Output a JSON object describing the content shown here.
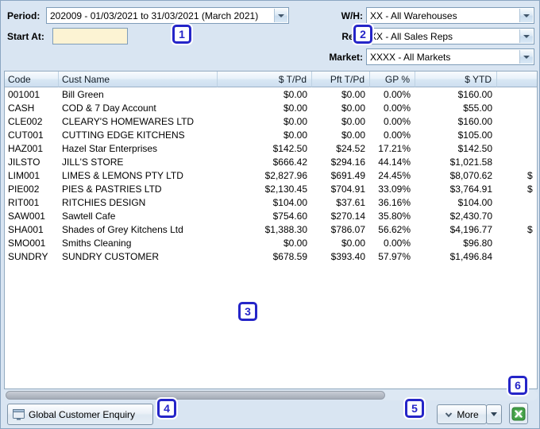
{
  "filters": {
    "period": {
      "label": "Period:",
      "value": "202009 - 01/03/2021 to 31/03/2021 (March 2021)"
    },
    "start_at": {
      "label": "Start At:",
      "value": ""
    },
    "warehouse": {
      "label": "W/H:",
      "value": "XX - All Warehouses"
    },
    "rep": {
      "label": "Rep:",
      "value": "XX - All Sales Reps"
    },
    "market": {
      "label": "Market:",
      "value": "XXXX - All Markets"
    }
  },
  "table": {
    "columns": [
      "Code",
      "Cust Name",
      "$ T/Pd",
      "Pft T/Pd",
      "GP %",
      "$ YTD",
      ""
    ],
    "rows": [
      [
        "001001",
        "Bill Green",
        "$0.00",
        "$0.00",
        "0.00%",
        "$160.00",
        ""
      ],
      [
        "CASH",
        "COD & 7 Day Account",
        "$0.00",
        "$0.00",
        "0.00%",
        "$55.00",
        ""
      ],
      [
        "CLE002",
        "CLEARY'S HOMEWARES LTD",
        "$0.00",
        "$0.00",
        "0.00%",
        "$160.00",
        ""
      ],
      [
        "CUT001",
        "CUTTING EDGE KITCHENS",
        "$0.00",
        "$0.00",
        "0.00%",
        "$105.00",
        ""
      ],
      [
        "HAZ001",
        "Hazel Star Enterprises",
        "$142.50",
        "$24.52",
        "17.21%",
        "$142.50",
        ""
      ],
      [
        "JILSTO",
        "JILL'S STORE",
        "$666.42",
        "$294.16",
        "44.14%",
        "$1,021.58",
        ""
      ],
      [
        "LIM001",
        "LIMES & LEMONS PTY LTD",
        "$2,827.96",
        "$691.49",
        "24.45%",
        "$8,070.62",
        "$"
      ],
      [
        "PIE002",
        "PIES & PASTRIES LTD",
        "$2,130.45",
        "$704.91",
        "33.09%",
        "$3,764.91",
        "$"
      ],
      [
        "RIT001",
        "RITCHIES DESIGN",
        "$104.00",
        "$37.61",
        "36.16%",
        "$104.00",
        ""
      ],
      [
        "SAW001",
        "Sawtell Cafe",
        "$754.60",
        "$270.14",
        "35.80%",
        "$2,430.70",
        ""
      ],
      [
        "SHA001",
        "Shades of Grey Kitchens Ltd",
        "$1,388.30",
        "$786.07",
        "56.62%",
        "$4,196.77",
        "$"
      ],
      [
        "SMO001",
        "Smiths Cleaning",
        "$0.00",
        "$0.00",
        "0.00%",
        "$96.80",
        ""
      ],
      [
        "SUNDRY",
        "SUNDRY CUSTOMER",
        "$678.59",
        "$393.40",
        "57.97%",
        "$1,496.84",
        ""
      ]
    ]
  },
  "footer": {
    "enquiry_label": "Global Customer Enquiry",
    "more_label": "More",
    "icons": {
      "enquiry_button_icon": "form-window",
      "more_button_icon": "chevron-down",
      "more_dropdown_icon": "dropdown-arrow",
      "excel_button_icon": "excel-export",
      "select_caret_icon": "chevron-down"
    }
  },
  "annotations": [
    "1",
    "2",
    "3",
    "4",
    "5",
    "6"
  ]
}
